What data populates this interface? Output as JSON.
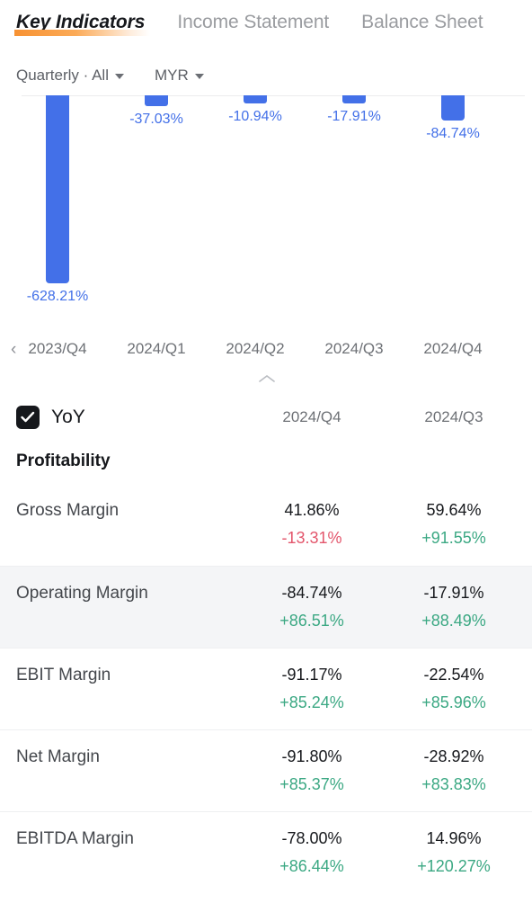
{
  "tabs": [
    {
      "label": "Key Indicators",
      "active": true
    },
    {
      "label": "Income Statement",
      "active": false
    },
    {
      "label": "Balance Sheet",
      "active": false
    }
  ],
  "filters": [
    {
      "label": "Quarterly · All",
      "icon": "chevron-down-icon"
    },
    {
      "label": "MYR",
      "icon": "chevron-down-icon"
    }
  ],
  "chart_nav": {
    "prev_icon": "chevron-left-icon",
    "collapse_icon": "chevron-up-icon"
  },
  "chart_data": {
    "type": "bar",
    "title": "",
    "xlabel": "",
    "ylabel": "",
    "unit": "%",
    "categories": [
      "2023/Q4",
      "2024/Q1",
      "2024/Q2",
      "2024/Q3",
      "2024/Q4"
    ],
    "values": [
      -628.21,
      -37.03,
      -10.94,
      -17.91,
      -84.74
    ],
    "labels": [
      "-628.21%",
      "-37.03%",
      "-10.94%",
      "-17.91%",
      "-84.74%"
    ],
    "series": [
      {
        "name": "Operating Margin",
        "values": [
          -628.21,
          -37.03,
          -10.94,
          -17.91,
          -84.74
        ]
      }
    ],
    "ylim": [
      -660,
      0
    ],
    "grid": false,
    "legend": "none",
    "bar_color": "#4370e8",
    "label_color": "#4370e8"
  },
  "table": {
    "toggle": {
      "label": "YoY",
      "checked": true,
      "icon": "checkbox-checked-icon"
    },
    "columns": [
      "2024/Q4",
      "2024/Q3"
    ],
    "section": "Profitability",
    "rows": [
      {
        "label": "Gross Margin",
        "highlight": false,
        "cells": [
          {
            "value": "41.86%",
            "change": "-13.31%",
            "direction": "down"
          },
          {
            "value": "59.64%",
            "change": "+91.55%",
            "direction": "up"
          }
        ]
      },
      {
        "label": "Operating Margin",
        "highlight": true,
        "cells": [
          {
            "value": "-84.74%",
            "change": "+86.51%",
            "direction": "up"
          },
          {
            "value": "-17.91%",
            "change": "+88.49%",
            "direction": "up"
          }
        ]
      },
      {
        "label": "EBIT Margin",
        "highlight": false,
        "cells": [
          {
            "value": "-91.17%",
            "change": "+85.24%",
            "direction": "up"
          },
          {
            "value": "-22.54%",
            "change": "+85.96%",
            "direction": "up"
          }
        ]
      },
      {
        "label": "Net Margin",
        "highlight": false,
        "cells": [
          {
            "value": "-91.80%",
            "change": "+85.37%",
            "direction": "up"
          },
          {
            "value": "-28.92%",
            "change": "+83.83%",
            "direction": "up"
          }
        ]
      },
      {
        "label": "EBITDA Margin",
        "highlight": false,
        "cells": [
          {
            "value": "-78.00%",
            "change": "+86.44%",
            "direction": "up"
          },
          {
            "value": "14.96%",
            "change": "+120.27%",
            "direction": "up"
          }
        ]
      }
    ]
  },
  "colors": {
    "accent": "#f79233",
    "bar": "#4370e8",
    "positive": "#3ba883",
    "negative": "#e3566c",
    "row_highlight": "#f4f5f7"
  }
}
